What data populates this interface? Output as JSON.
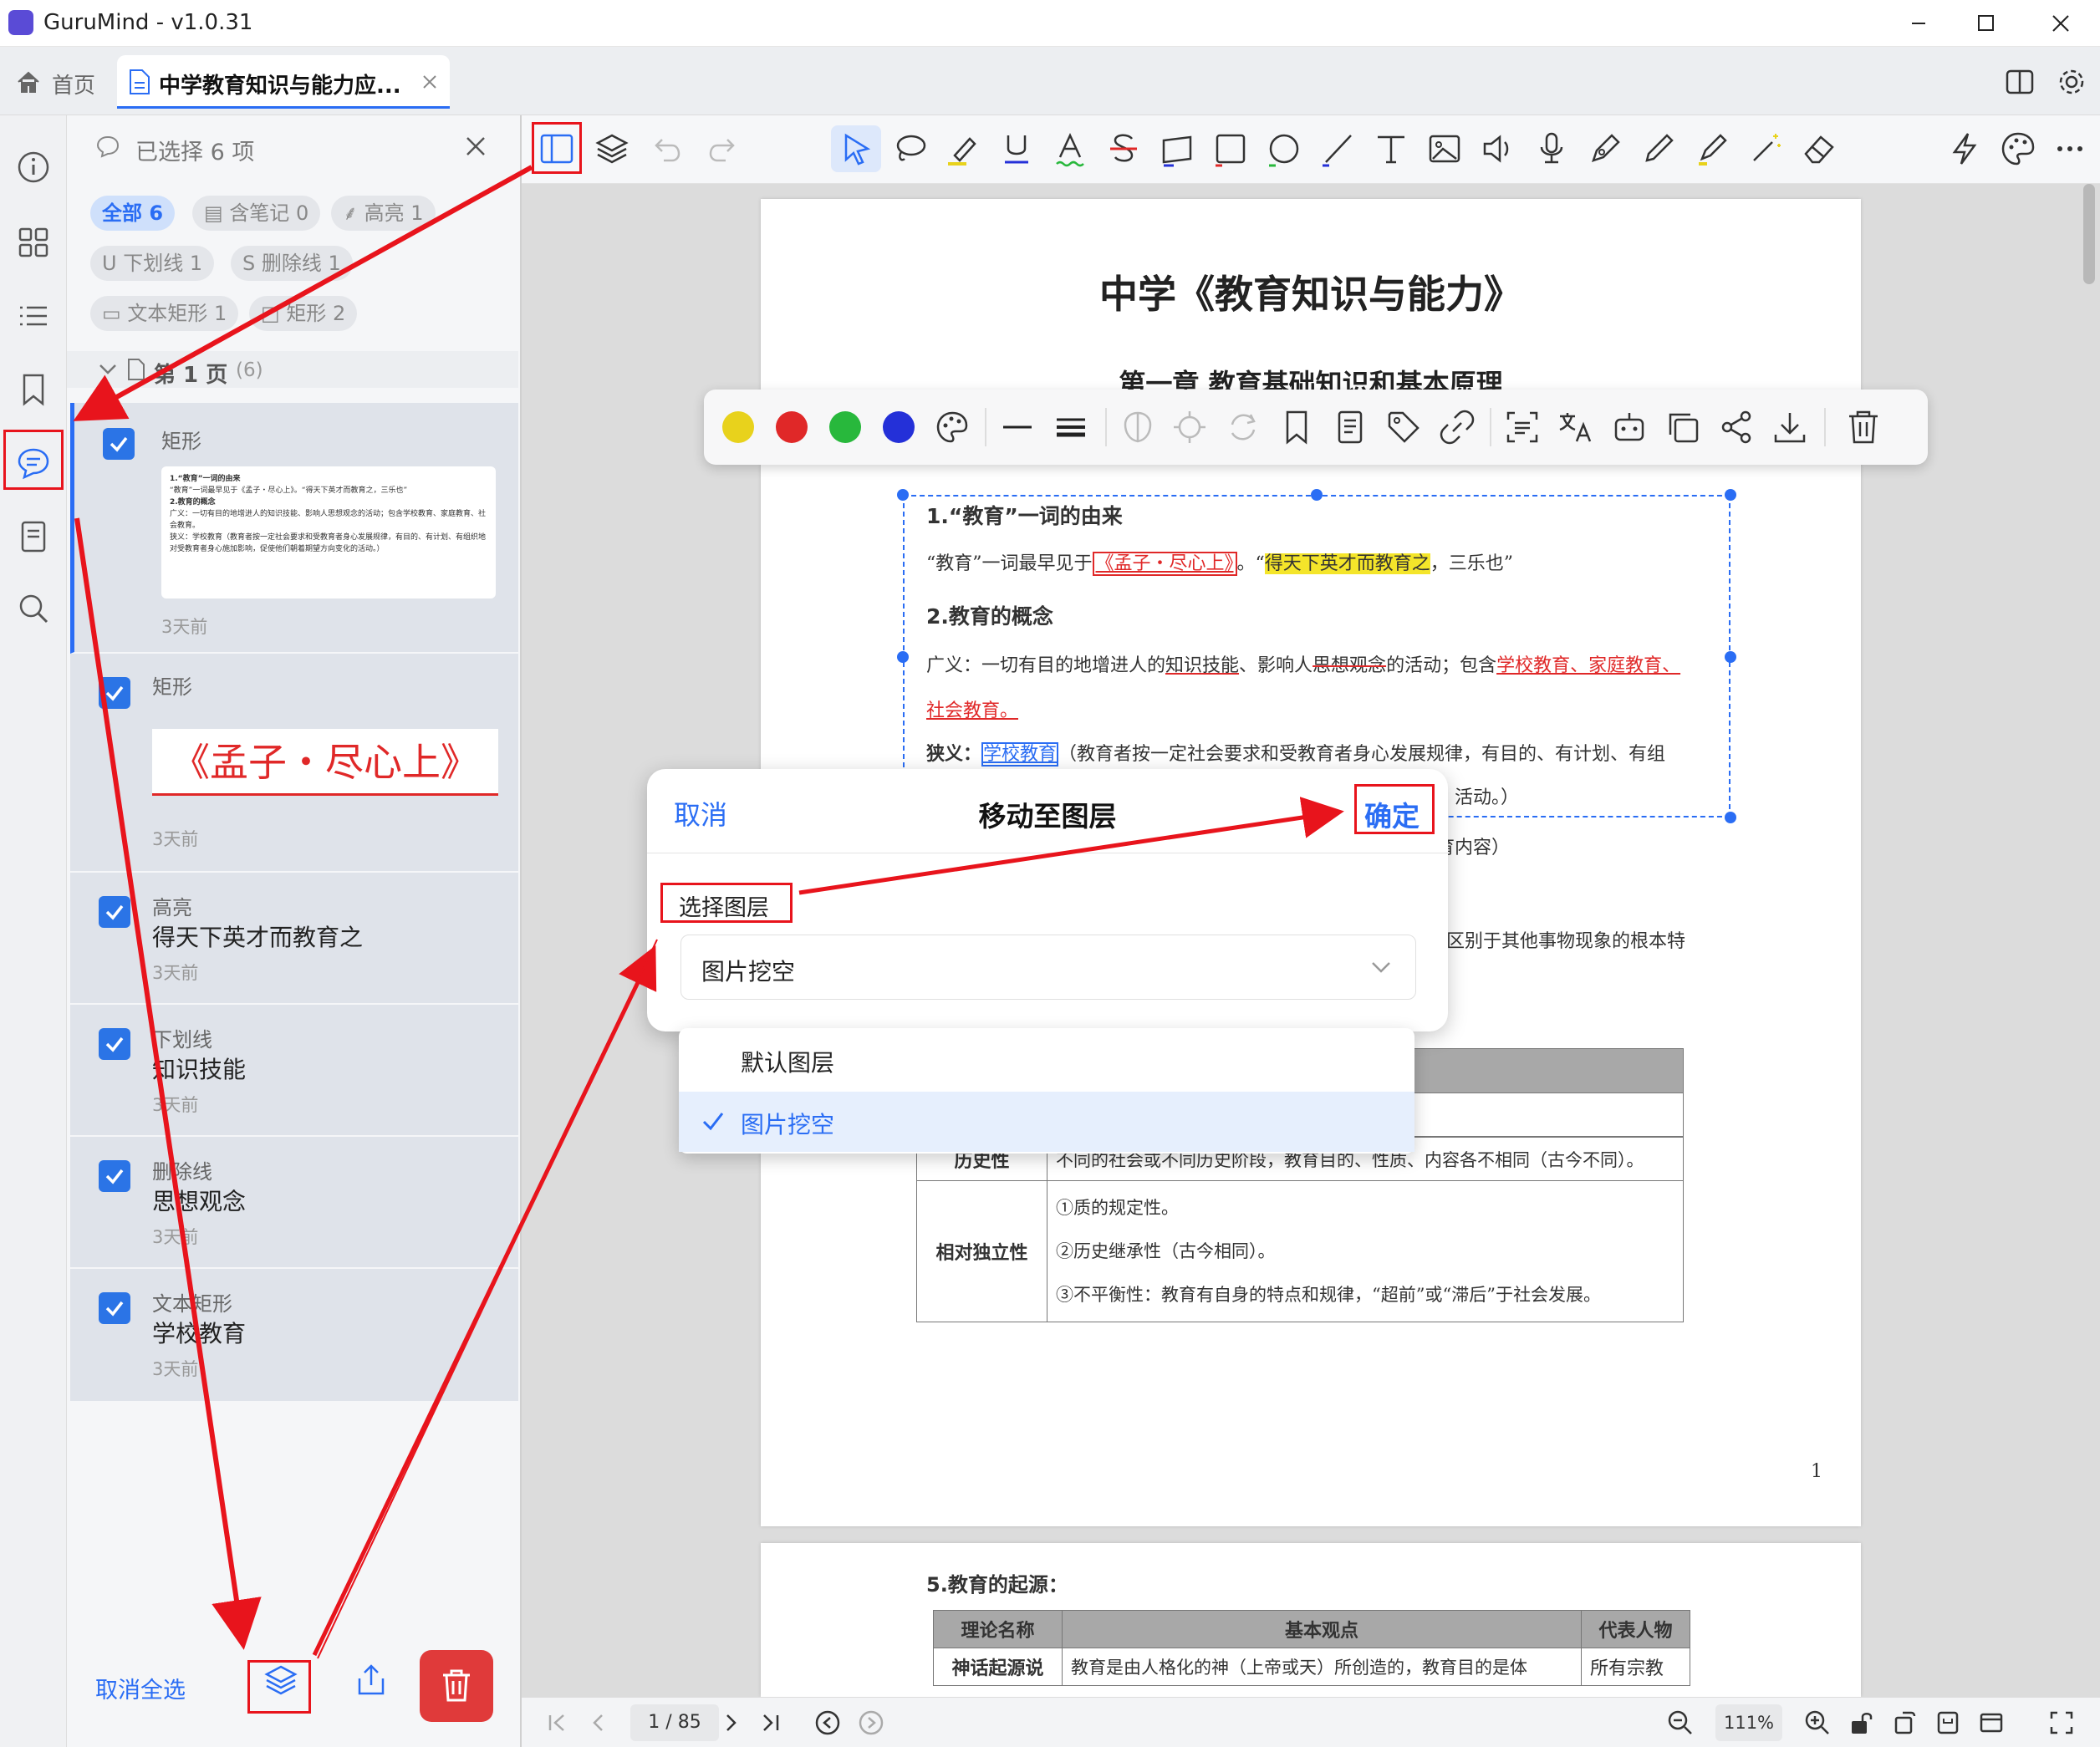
{
  "app": {
    "title": "GuruMind - v1.0.31"
  },
  "tabs": [
    {
      "label": "首页"
    },
    {
      "label": "中学教育知识与能力应..."
    }
  ],
  "left_panel": {
    "header": "已选择 6 项",
    "filters": [
      {
        "label": "全部",
        "count": "6"
      },
      {
        "label": "含笔记",
        "count": "0"
      },
      {
        "label": "高亮",
        "count": "1"
      },
      {
        "label": "下划线",
        "count": "1"
      },
      {
        "label": "删除线",
        "count": "1"
      },
      {
        "label": "文本矩形",
        "count": "1"
      },
      {
        "label": "矩形",
        "count": "2"
      }
    ],
    "group": {
      "label": "第 1 页",
      "count": "(6)"
    },
    "cards": [
      {
        "type": "矩形",
        "text": "",
        "time": "3天前"
      },
      {
        "type": "矩形",
        "text": "《孟子・尽心上》",
        "time": "3天前"
      },
      {
        "type": "高亮",
        "text": "得天下英才而教育之",
        "time": "3天前"
      },
      {
        "type": "下划线",
        "text": "知识技能",
        "time": "3天前"
      },
      {
        "type": "删除线",
        "text": "思想观念",
        "time": "3天前"
      },
      {
        "type": "文本矩形",
        "text": "学校教育",
        "time": "3天前"
      }
    ],
    "thumb": {
      "l1": "1.“教育”一词的由来",
      "l2": "“教育”一词最早见于《孟子・尽心上》。“得天下英才而教育之，三乐也”",
      "l3": "2.教育的概念",
      "l4": "广义：一切有目的地增进人的知识技能、影响人思想观念的活动；包含学校教育、家庭教育、社会教育。",
      "l5": "狭义：学校教育（教育者按一定社会要求和受教育者身心发展规律，有目的、有计划、有组织地对受教育者身心施加影响，促使他们朝着期望方向变化的活动。）"
    },
    "footer": {
      "deselect": "取消全选"
    }
  },
  "document": {
    "title": "中学《教育知识与能力》",
    "chapter": "第一章  教育基础知识和基本原理",
    "s1_heading": "1.“教育”一词的由来",
    "s1_a": "“教育”一词最早见于",
    "s1_b": "《孟子・尽心上》",
    "s1_c": "。“",
    "s1_d": "得天下英才而教育之",
    "s1_e": "，三乐也”",
    "s2_heading": "2.教育的概念",
    "s2_a": "广义：一切有目的地增进人的",
    "s2_b": "知识技能",
    "s2_c": "、影响人",
    "s2_d": "思想观念",
    "s2_e": "的活动；包含",
    "s2_f": "学校教育、家庭教育、",
    "s2_g": "社会教育。",
    "s3_a": "狭义：",
    "s3_b": "学校教育",
    "s3_c": "（教育者按一定社会要求和受教育者身心发展规律，有目的、有计划、有组",
    "s3_d": "活动。）",
    "frag1": "育内容）",
    "frag2": "区别于其他事物现象的根本特",
    "table_rows": [
      {
        "head": "历史性",
        "lines": [
          "不同的社会或不同历史阶段，教育目的、性质、内容各不相同（古今不同）。"
        ]
      },
      {
        "head": "相对独立性",
        "lines": [
          "①质的规定性。",
          "②历史继承性（古今相同）。",
          "③不平衡性：教育有自身的特点和规律，“超前”或“滞后”于社会发展。"
        ]
      }
    ],
    "page_number": "1",
    "p2_heading": "5.教育的起源：",
    "p2_cols": [
      "理论名称",
      "基本观点",
      "代表人物"
    ],
    "p2_row": [
      "神话起源说",
      "教育是由人格化的神（上帝或天）所创造的，教育目的是体",
      "所有宗教"
    ]
  },
  "dialog": {
    "cancel": "取消",
    "title": "移动至图层",
    "confirm": "确定",
    "label": "选择图层",
    "selected": "图片挖空",
    "options": [
      "默认图层",
      "图片挖空"
    ]
  },
  "bottom": {
    "page": "1 / 85",
    "zoom": "111%"
  },
  "colors": {
    "accent": "#2a6df4",
    "danger": "#e03a3a",
    "annot_red": "#e8141c",
    "highlight": "#f4e52a",
    "yellow": "#e8d21c",
    "red": "#e02828",
    "green": "#28b83c",
    "blue": "#2430d8"
  }
}
